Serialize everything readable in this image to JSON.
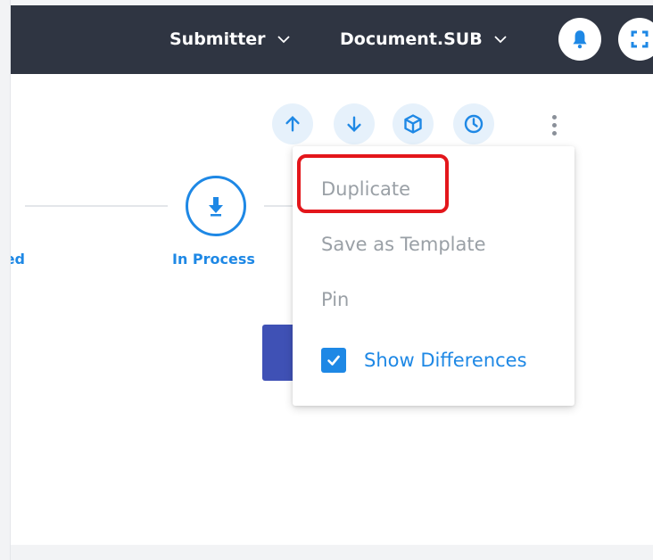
{
  "header": {
    "submitter_label": "Submitter",
    "document_label": "Document.SUB",
    "bell_icon": "bell-icon",
    "expand_icon": "expand-icon"
  },
  "toolbar": {
    "icons": [
      "arrow-up-icon",
      "arrow-down-icon",
      "cube-icon",
      "clock-icon",
      "kebab-menu-icon"
    ]
  },
  "progress": {
    "previous_step_label_fragment": "ed",
    "current_step_label": "In Process",
    "current_step_icon": "arrow-down-icon"
  },
  "context_menu": {
    "items": [
      {
        "label": "Duplicate"
      },
      {
        "label": "Save as Template"
      },
      {
        "label": "Pin"
      }
    ],
    "show_differences": {
      "label": "Show Differences",
      "checked": true
    }
  },
  "colors": {
    "header_bg": "#2f3542",
    "accent": "#1e88e5",
    "primary_button": "#3f51b5",
    "highlight": "#e3161b",
    "muted_text": "#9aa0a6"
  }
}
